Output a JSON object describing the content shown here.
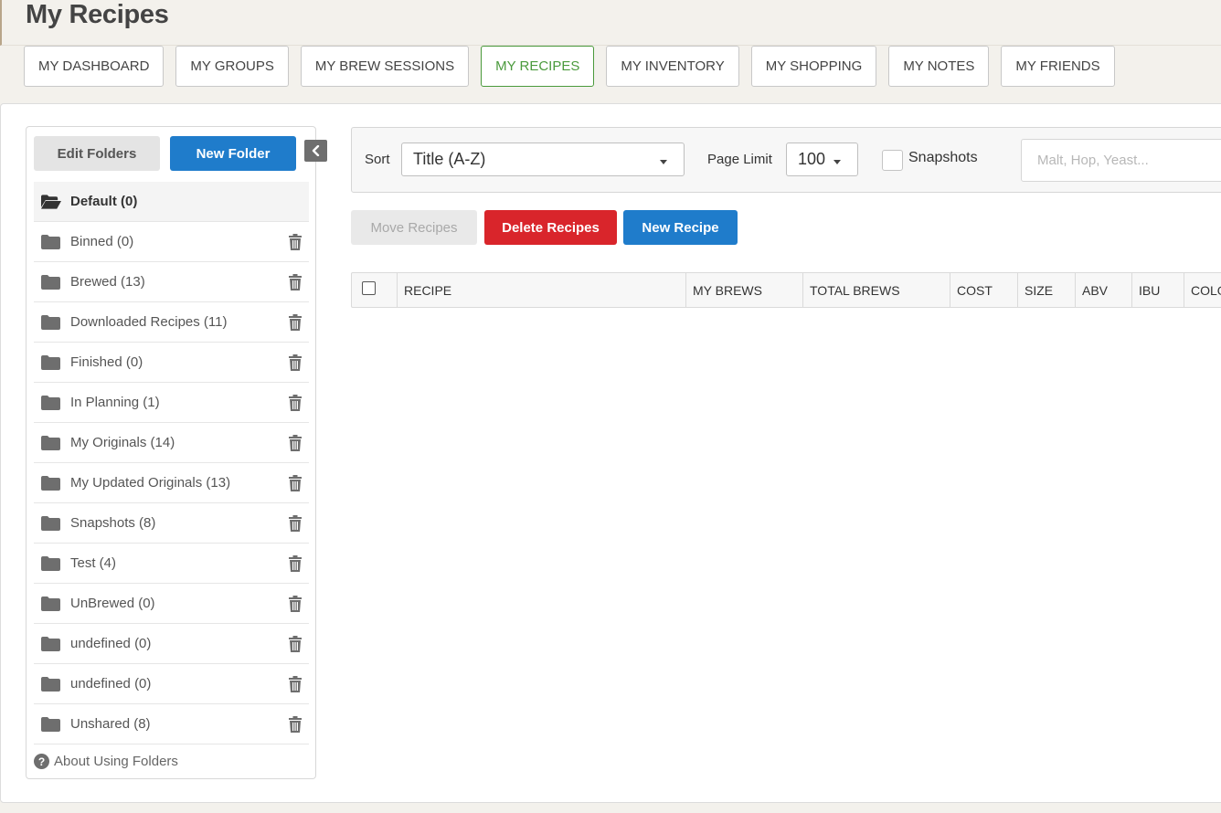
{
  "page": {
    "title": "My Recipes"
  },
  "tabs": [
    {
      "label": "MY DASHBOARD",
      "active": false
    },
    {
      "label": "MY GROUPS",
      "active": false
    },
    {
      "label": "MY BREW SESSIONS",
      "active": false
    },
    {
      "label": "MY RECIPES",
      "active": true
    },
    {
      "label": "MY INVENTORY",
      "active": false
    },
    {
      "label": "MY SHOPPING",
      "active": false
    },
    {
      "label": "MY NOTES",
      "active": false
    },
    {
      "label": "MY FRIENDS",
      "active": false
    }
  ],
  "sidebar": {
    "edit_folders_label": "Edit Folders",
    "new_folder_label": "New Folder",
    "collapse_icon": "chevron-left-icon",
    "folders": [
      {
        "label": "Default (0)",
        "icon": "folder-open-icon"
      },
      {
        "label": "Binned (0)",
        "icon": "folder-icon"
      },
      {
        "label": "Brewed (13)",
        "icon": "folder-icon"
      },
      {
        "label": "Downloaded Recipes (11)",
        "icon": "folder-icon"
      },
      {
        "label": "Finished (0)",
        "icon": "folder-icon"
      },
      {
        "label": "In Planning (1)",
        "icon": "folder-icon"
      },
      {
        "label": "My Originals (14)",
        "icon": "folder-icon"
      },
      {
        "label": "My Updated Originals (13)",
        "icon": "folder-icon"
      },
      {
        "label": "Snapshots (8)",
        "icon": "folder-icon"
      },
      {
        "label": "Test (4)",
        "icon": "folder-icon"
      },
      {
        "label": "UnBrewed (0)",
        "icon": "folder-icon"
      },
      {
        "label": "undefined (0)",
        "icon": "folder-icon"
      },
      {
        "label": "undefined (0)",
        "icon": "folder-icon"
      },
      {
        "label": "Unshared (8)",
        "icon": "folder-icon"
      }
    ],
    "about_label": "About Using Folders"
  },
  "toolbar": {
    "sort_label": "Sort",
    "sort_value": "Title (A-Z)",
    "page_limit_label": "Page Limit",
    "page_limit_value": "100",
    "snapshots_label": "Snapshots",
    "search_placeholder": "Malt, Hop, Yeast..."
  },
  "actions": {
    "move_label": "Move Recipes",
    "delete_label": "Delete Recipes",
    "new_label": "New Recipe"
  },
  "table": {
    "columns": [
      "RECIPE",
      "MY BREWS",
      "TOTAL BREWS",
      "COST",
      "SIZE",
      "ABV",
      "IBU",
      "COLOR"
    ]
  },
  "colors": {
    "accent_green": "#4a9a3c",
    "primary_blue": "#1f7ccb",
    "danger_red": "#d9252b"
  }
}
